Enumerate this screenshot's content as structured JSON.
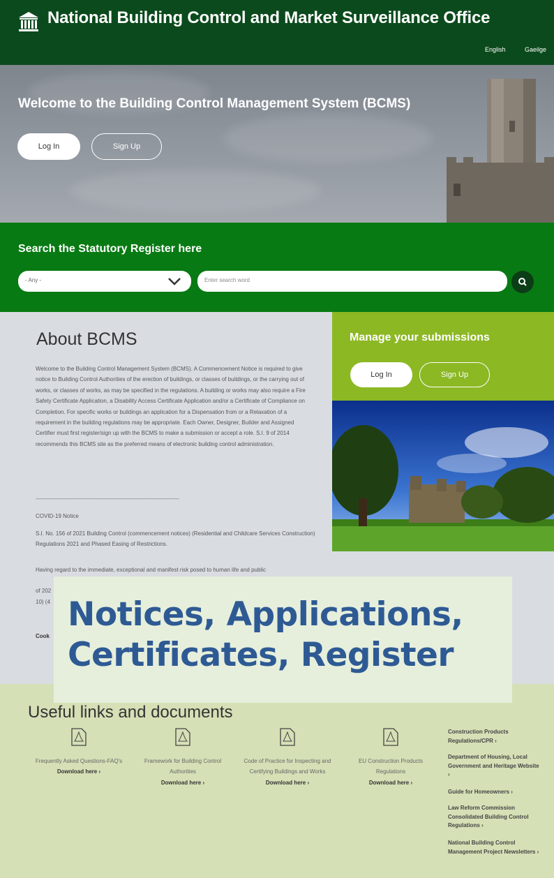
{
  "header": {
    "title": "National Building Control and Market Surveillance Office",
    "lang_en": "English",
    "lang_ga": "Gaeilge",
    "icon": "government-building-icon"
  },
  "hero": {
    "title": "Welcome to the Building Control Management System (BCMS)",
    "login_label": "Log In",
    "signup_label": "Sign Up"
  },
  "search": {
    "title": "Search the Statutory Register here",
    "select_value": "- Any -",
    "placeholder": "Enter search word",
    "button_icon": "search-icon"
  },
  "about": {
    "title": "About BCMS",
    "body": "Welcome to the Building Control Management System (BCMS). A Commencement Notice is required to give notice to Building Control Authorities of the erection of buildings, or classes of buildings, or the carrying out of works, or classes of works, as may be specified in the regulations. A building or works may also require a Fire Safety Certificate Application, a Disability Access Certificate Application and/or a Certificate of Compliance on Completion. For specific works or buildings an application for a Dispensation from or a Relaxation of a requirement in the building regulations may be appropriate. Each Owner, Designer, Builder and Assigned Certifier must first register/sign up with the BCMS to make a submission or accept a role. S.I. 9 of 2014 recommends this BCMS site as the preferred means of electronic building control administration.",
    "divider": "-----------------------------------------------------------------------------------------------",
    "covid_title": "COVID-19 Notice",
    "covid_text": "S.I. No. 156 of 2021 Building Control (commencement notices) (Residential and Childcare Services Construction) Regulations 2021 and Phased Easing of Restrictions.",
    "regard_text": "Having regard to the immediate, exceptional and manifest risk posed to human life and public",
    "partial_1": "of 202",
    "partial_2": "10) (4",
    "cookie_text": "Cook"
  },
  "manage": {
    "title": "Manage your submissions",
    "login_label": "Log In",
    "signup_label": "Sign Up"
  },
  "links": {
    "title": "Useful links and documents",
    "docs": [
      {
        "name": "Frequently Asked Questions-FAQ's",
        "download": "Download here ›",
        "icon": "pdf-icon"
      },
      {
        "name": "Framework for Building Control Authorities",
        "download": "Download here ›",
        "icon": "pdf-icon"
      },
      {
        "name": "Code of Practice for Inspecting and Certifying Buildings and Works",
        "download": "Download here ›",
        "icon": "pdf-icon"
      },
      {
        "name": "EU Construction Products Regulations",
        "download": "Download here ›",
        "icon": "pdf-icon"
      }
    ],
    "side": [
      "Construction Products Regulations/CPR ›",
      "Department of Housing, Local Government and Heritage Website ›",
      "Guide for Homeowners ›",
      "Law Reform Commission Consolidated Building Control Regulations ›",
      "National Building Control Management Project Newsletters ›"
    ]
  },
  "overlay": {
    "line1": "Notices, Applications,",
    "line2": "Certificates, Register"
  },
  "colors": {
    "header": "#0b4a1c",
    "search_band": "#087a13",
    "manage": "#8cb824",
    "links_bg": "#d5e0b6",
    "overlay_text": "#2e5a94"
  }
}
